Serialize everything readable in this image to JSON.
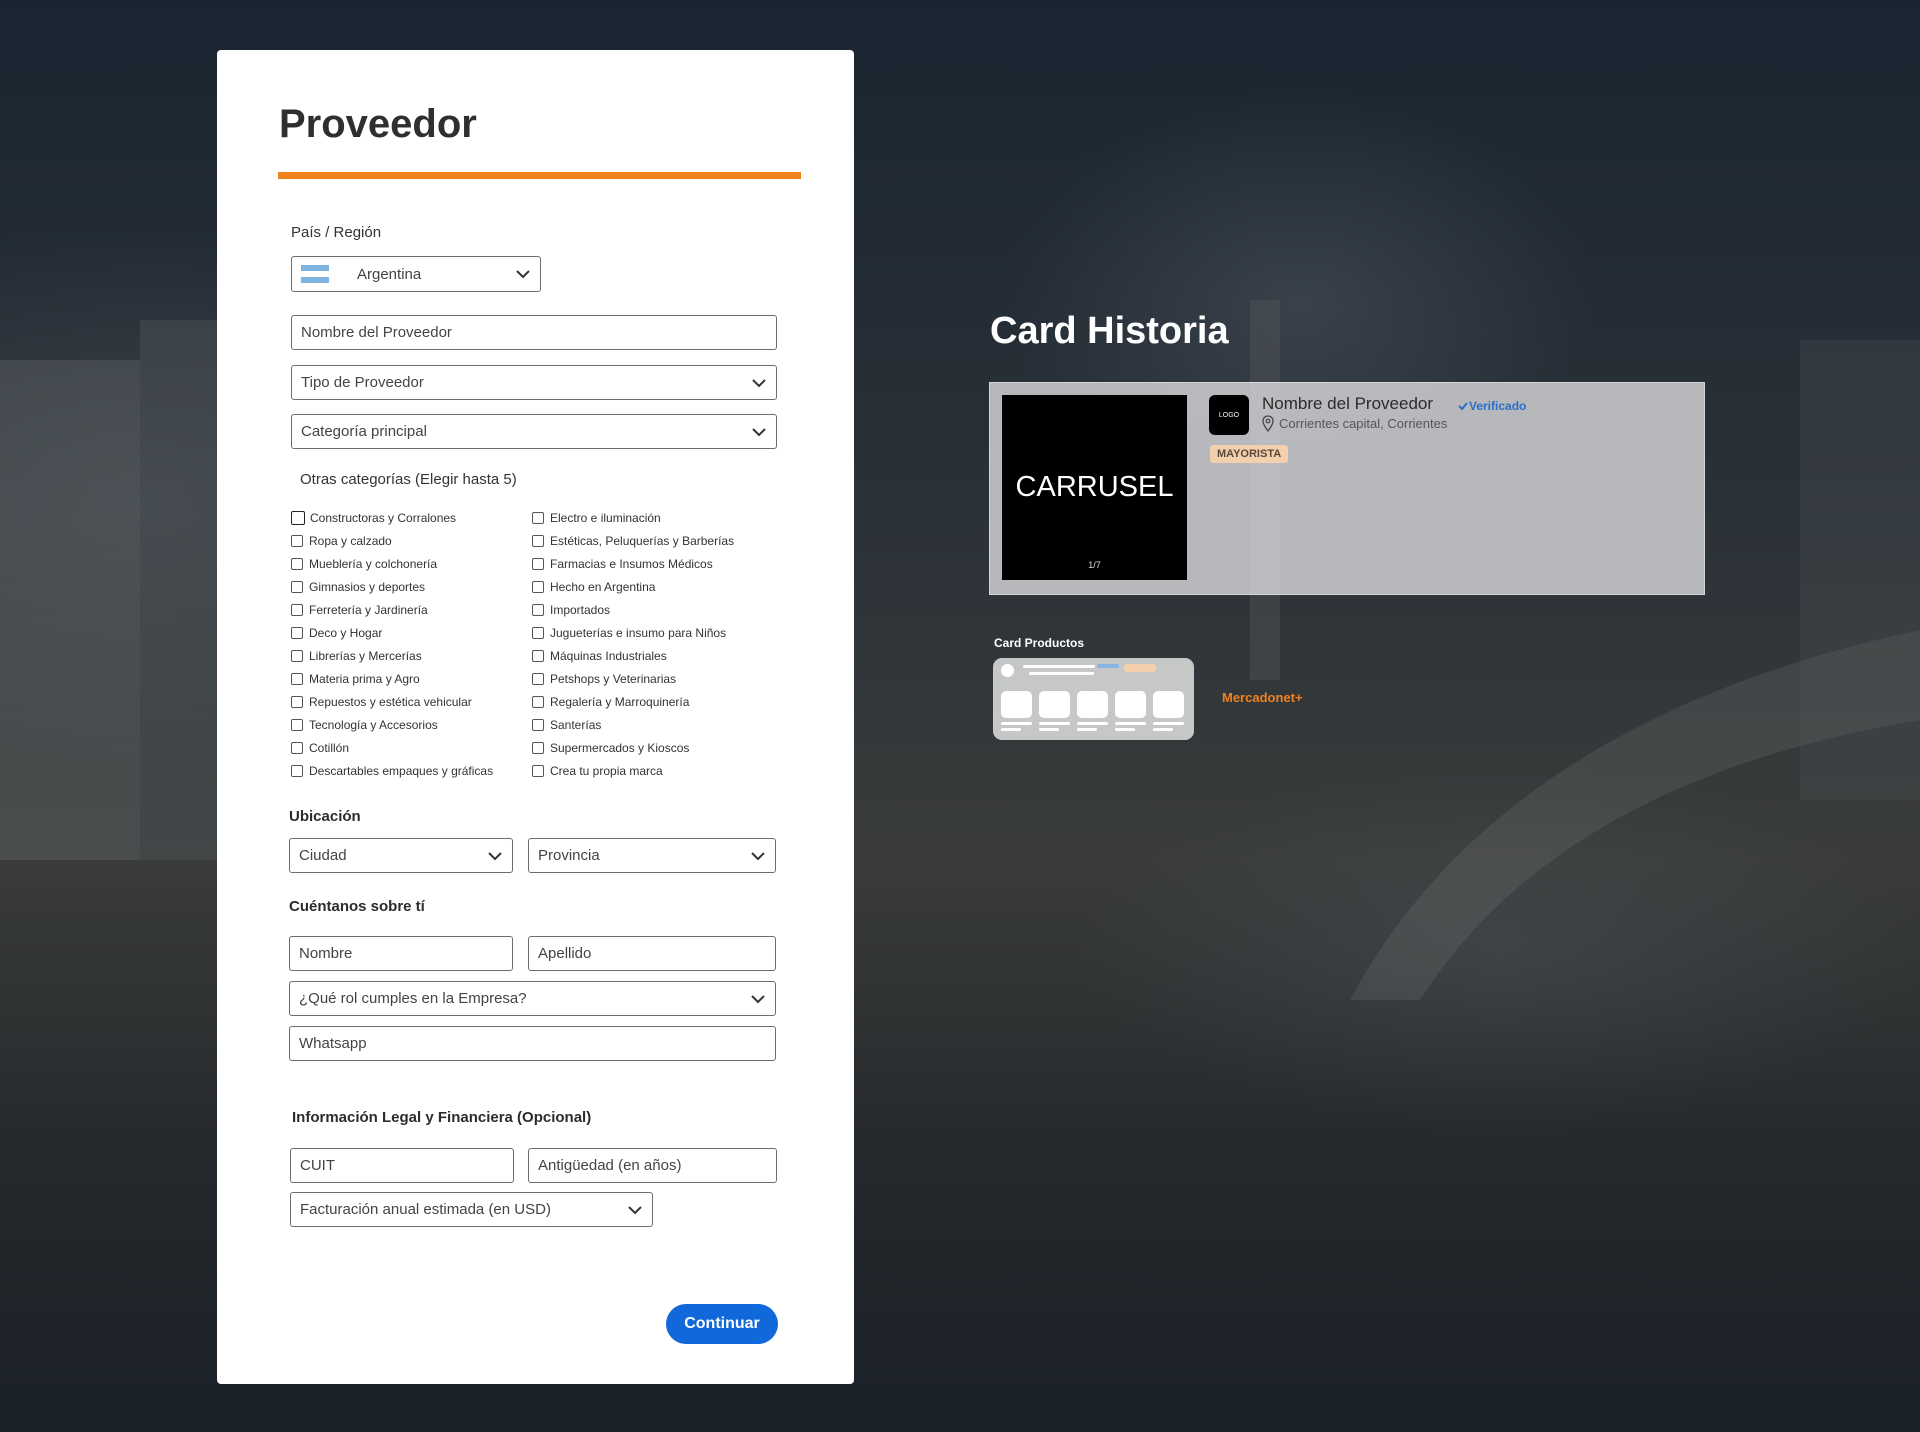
{
  "form": {
    "title": "Proveedor",
    "pais_label": "País / Región",
    "pais_value": "Argentina",
    "nombre_proveedor_placeholder": "Nombre del Proveedor",
    "tipo_proveedor_placeholder": "Tipo de Proveedor",
    "categoria_principal_placeholder": "Categoría principal",
    "otras_categorias_label": "Otras categorías (Elegir hasta 5)",
    "categories_left": [
      "Constructoras y Corralones",
      "Ropa y calzado",
      "Mueblería y colchonería",
      "Gimnasios y deportes",
      "Ferretería y Jardinería",
      "Deco y Hogar",
      "Librerías y Mercerías",
      "Materia prima y Agro",
      "Repuestos y estética vehicular",
      "Tecnología y Accesorios",
      "Cotillón",
      "Descartables empaques y gráficas"
    ],
    "categories_right": [
      "Electro e iluminación",
      "Estéticas, Peluquerías y Barberías",
      "Farmacias e Insumos Médicos",
      "Hecho en Argentina",
      "Importados",
      "Jugueterías e insumo para Niños",
      "Máquinas Industriales",
      "Petshops y Veterinarias",
      "Regalería y Marroquinería",
      "Santerías",
      "Supermercados y Kioscos",
      "Crea tu propia marca"
    ],
    "ubicacion_label": "Ubicación",
    "ciudad_placeholder": "Ciudad",
    "provincia_placeholder": "Provincia",
    "cuentanos_label": "Cuéntanos sobre tí",
    "nombre_placeholder": "Nombre",
    "apellido_placeholder": "Apellido",
    "rol_placeholder": "¿Qué rol cumples en la Empresa?",
    "whatsapp_placeholder": "Whatsapp",
    "legal_label": "Información Legal y Financiera (Opcional)",
    "cuit_placeholder": "CUIT",
    "antiguedad_placeholder": "Antigüedad (en años)",
    "facturacion_placeholder": "Facturación anual estimada (en USD)",
    "continuar_label": "Continuar"
  },
  "historia": {
    "title": "Card Historia",
    "carrusel_label": "CARRUSEL",
    "carrusel_count": "1/7",
    "logo_label": "LOGO",
    "provider_name": "Nombre del Proveedor",
    "verified_label": "Verificado",
    "location": "Corrientes capital, Corrientes",
    "badge": "MAYORISTA"
  },
  "productos": {
    "title": "Card Productos",
    "brand": "Mercadonet+"
  },
  "colors": {
    "accent_orange": "#f0821e",
    "primary_blue": "#1068da",
    "verified_blue": "#2a6fc9"
  }
}
